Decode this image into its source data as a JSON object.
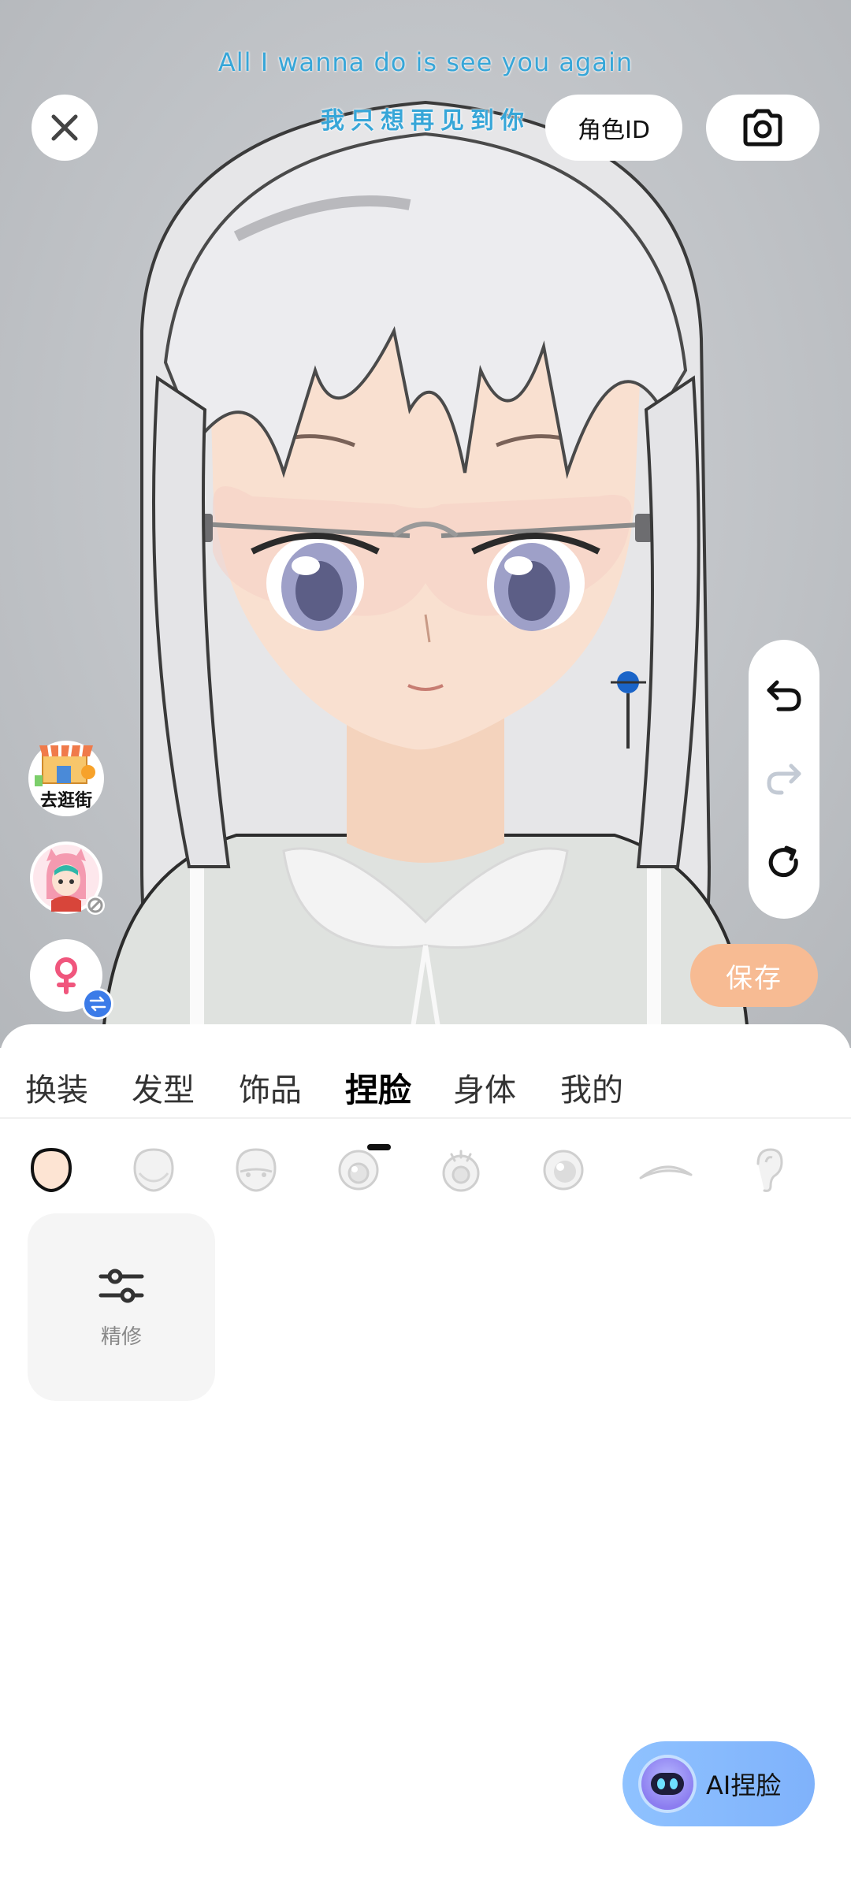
{
  "lyrics": {
    "english": "All I wanna do is see you again",
    "chinese": "我只想再见到你"
  },
  "header": {
    "close_icon": "close-icon",
    "role_id_label": "角色ID",
    "camera_icon": "camera-icon"
  },
  "side_actions": {
    "shop_label": "去逛街",
    "character_icon": "character-avatar",
    "gender_icon": "female-symbol-icon",
    "swap_icon": "swap-icon"
  },
  "history_controls": {
    "undo_icon": "undo-icon",
    "redo_icon": "redo-icon",
    "reset_icon": "reset-icon"
  },
  "save_label": "保存",
  "tabs": [
    {
      "label": "换装",
      "active": false
    },
    {
      "label": "发型",
      "active": false
    },
    {
      "label": "饰品",
      "active": false
    },
    {
      "label": "捏脸",
      "active": true
    },
    {
      "label": "身体",
      "active": false
    },
    {
      "label": "我的",
      "active": false
    }
  ],
  "face_subcategories": [
    {
      "icon": "face-shape-icon",
      "selected": true
    },
    {
      "icon": "face-contour-icon",
      "selected": false
    },
    {
      "icon": "face-features-icon",
      "selected": false
    },
    {
      "icon": "eye-icon",
      "selected": false
    },
    {
      "icon": "eyelash-icon",
      "selected": false
    },
    {
      "icon": "pupil-icon",
      "selected": false
    },
    {
      "icon": "eyebrow-icon",
      "selected": false
    },
    {
      "icon": "ear-icon",
      "selected": false
    }
  ],
  "tool_card": {
    "icon": "sliders-icon",
    "label": "精修"
  },
  "ai_button": {
    "label": "AI捏脸",
    "icon": "robot-avatar-icon"
  },
  "colors": {
    "accent_save": "#f7bb93",
    "lyric": "#37a6d8",
    "ai_button": "#8fc2ff"
  }
}
